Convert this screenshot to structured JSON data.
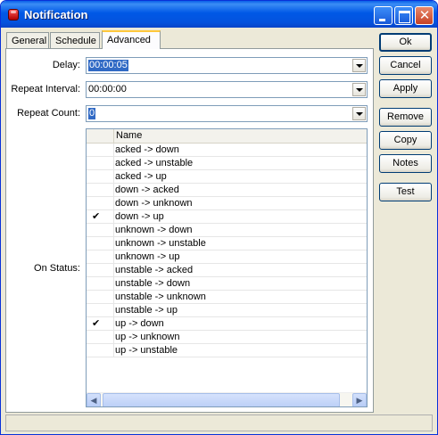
{
  "window": {
    "title": "Notification"
  },
  "tabs": [
    {
      "label": "General"
    },
    {
      "label": "Schedule"
    },
    {
      "label": "Advanced",
      "active": true
    }
  ],
  "form": {
    "delay_label": "Delay:",
    "delay_value": "00:00:05",
    "repeat_interval_label": "Repeat Interval:",
    "repeat_interval_value": "00:00:00",
    "repeat_count_label": "Repeat Count:",
    "repeat_count_value": "0",
    "on_status_label": "On Status:"
  },
  "status_list": {
    "header": "Name",
    "items": [
      {
        "name": "acked -> down",
        "checked": false
      },
      {
        "name": "acked -> unstable",
        "checked": false
      },
      {
        "name": "acked -> up",
        "checked": false
      },
      {
        "name": "down -> acked",
        "checked": false
      },
      {
        "name": "down -> unknown",
        "checked": false
      },
      {
        "name": "down -> up",
        "checked": true
      },
      {
        "name": "unknown -> down",
        "checked": false
      },
      {
        "name": "unknown -> unstable",
        "checked": false
      },
      {
        "name": "unknown -> up",
        "checked": false
      },
      {
        "name": "unstable -> acked",
        "checked": false
      },
      {
        "name": "unstable -> down",
        "checked": false
      },
      {
        "name": "unstable -> unknown",
        "checked": false
      },
      {
        "name": "unstable -> up",
        "checked": false
      },
      {
        "name": "up -> down",
        "checked": true
      },
      {
        "name": "up -> unknown",
        "checked": false
      },
      {
        "name": "up -> unstable",
        "checked": false
      }
    ]
  },
  "buttons": {
    "ok": "Ok",
    "cancel": "Cancel",
    "apply": "Apply",
    "remove": "Remove",
    "copy": "Copy",
    "notes": "Notes",
    "test": "Test"
  },
  "icons": {
    "checkmark": "✔",
    "scroll_left": "◀",
    "scroll_right": "▶",
    "close": "✕"
  }
}
